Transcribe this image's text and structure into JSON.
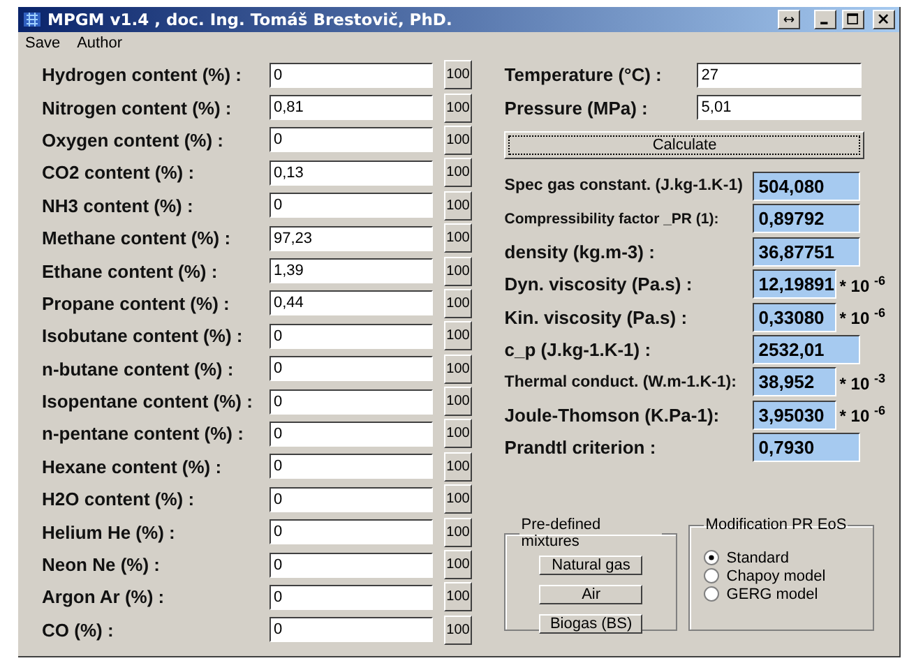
{
  "window": {
    "title": "MPGM v1.4 ,  doc. Ing. Tomáš Brestovič, PhD."
  },
  "menu": [
    "Save",
    "Author"
  ],
  "components": [
    {
      "label": "Hydrogen content (%) :",
      "value": "0",
      "button": "100"
    },
    {
      "label": "Nitrogen content  (%) :",
      "value": "0,81",
      "button": "100"
    },
    {
      "label": "Oxygen content (%) :",
      "value": "0",
      "button": "100"
    },
    {
      "label": "CO2 content (%) :",
      "value": "0,13",
      "button": "100"
    },
    {
      "label": "NH3 content (%) :",
      "value": "0",
      "button": "100"
    },
    {
      "label": "Methane content (%) :",
      "value": "97,23",
      "button": "100"
    },
    {
      "label": "Ethane content (%) :",
      "value": "1,39",
      "button": "100"
    },
    {
      "label": "Propane content (%) :",
      "value": "0,44",
      "button": "100"
    },
    {
      "label": "Isobutane content (%) :",
      "value": "0",
      "button": "100"
    },
    {
      "label": "n-butane content (%) :",
      "value": "0",
      "button": "100"
    },
    {
      "label": "Isopentane content (%) :",
      "value": "0",
      "button": "100"
    },
    {
      "label": "n-pentane content (%) :",
      "value": "0",
      "button": "100"
    },
    {
      "label": "Hexane content (%) :",
      "value": "0",
      "button": "100"
    },
    {
      "label": "H2O content (%) :",
      "value": "0",
      "button": "100"
    },
    {
      "label": "Helium He (%) :",
      "value": "0",
      "button": "100"
    },
    {
      "label": "Neon Ne (%) :",
      "value": "0",
      "button": "100"
    },
    {
      "label": "Argon Ar (%) :",
      "value": "0",
      "button": "100"
    },
    {
      "label": "CO (%) :",
      "value": "0",
      "button": "100"
    }
  ],
  "conditions": [
    {
      "label": "Temperature (°C) :",
      "value": "27"
    },
    {
      "label": "Pressure (MPa) :",
      "value": "5,01"
    }
  ],
  "calculate_button": "Calculate",
  "results": [
    {
      "kind": "small",
      "label": "Spec gas constant. (J.kg-1.K-1)",
      "value": "504,080"
    },
    {
      "kind": "tiny",
      "label": "Compressibility factor _PR (1):",
      "value": "0,89792"
    },
    {
      "kind": "normal",
      "label": "density (kg.m-3) :",
      "value": "36,87751"
    },
    {
      "kind": "normal",
      "label": "Dyn. viscosity (Pa.s) :",
      "value": "12,19891",
      "unit": "* 10 $^{-6}$"
    },
    {
      "kind": "normal",
      "label": "Kin. viscosity (Pa.s) :",
      "value": "0,33080",
      "unit": "* 10 $^{-6}$"
    },
    {
      "kind": "normal",
      "label": "c_p  (J.kg-1.K-1) :",
      "value": "2532,01"
    },
    {
      "kind": "small",
      "label": "Thermal conduct. (W.m-1.K-1):",
      "value": "38,952",
      "unit": "* 10 $^{-3}$"
    },
    {
      "kind": "normal",
      "label": "Joule-Thomson (K.Pa-1):",
      "value": "3,95030",
      "unit": "* 10 $^{-6}$"
    },
    {
      "kind": "normal",
      "label": "Prandtl criterion :",
      "value": "0,7930"
    }
  ],
  "mixtures": {
    "title": "Pre-defined mixtures",
    "buttons": [
      "Natural gas",
      "Air",
      "Biogas (BS)"
    ]
  },
  "eos": {
    "title": "Modification PR EoS",
    "options": [
      {
        "label": "Standard",
        "selected": true
      },
      {
        "label": "Chapoy model",
        "selected": false
      },
      {
        "label": "GERG model",
        "selected": false
      }
    ]
  }
}
